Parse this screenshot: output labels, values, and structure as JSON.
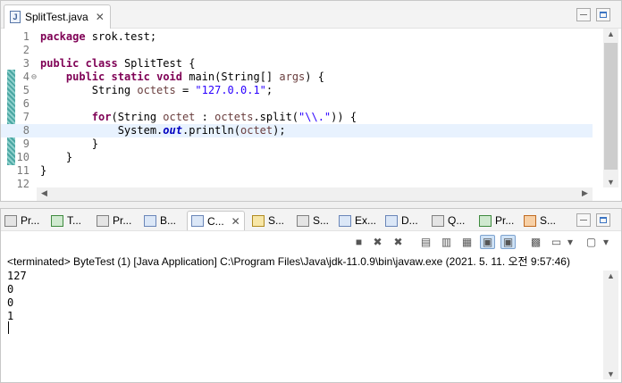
{
  "editor": {
    "tab_label": "SplitTest.java",
    "tab_close": "✕",
    "lines": [
      {
        "n": "1",
        "fold": "",
        "segs": [
          [
            "kw",
            "package"
          ],
          [
            "t",
            " srok.test;"
          ]
        ]
      },
      {
        "n": "2",
        "fold": "",
        "segs": []
      },
      {
        "n": "3",
        "fold": "",
        "segs": [
          [
            "kw",
            "public"
          ],
          [
            "t",
            " "
          ],
          [
            "kw",
            "class"
          ],
          [
            "t",
            " SplitTest {"
          ]
        ]
      },
      {
        "n": "4",
        "fold": "⊖",
        "segs": [
          [
            "t",
            "    "
          ],
          [
            "kw",
            "public"
          ],
          [
            "t",
            " "
          ],
          [
            "kw",
            "static"
          ],
          [
            "t",
            " "
          ],
          [
            "kw",
            "void"
          ],
          [
            "t",
            " main(String[] "
          ],
          [
            "var",
            "args"
          ],
          [
            "t",
            ") {"
          ]
        ]
      },
      {
        "n": "5",
        "fold": "",
        "segs": [
          [
            "t",
            "        String "
          ],
          [
            "var",
            "octets"
          ],
          [
            "t",
            " = "
          ],
          [
            "str",
            "\"127.0.0.1\""
          ],
          [
            "t",
            ";"
          ]
        ]
      },
      {
        "n": "6",
        "fold": "",
        "segs": []
      },
      {
        "n": "7",
        "fold": "",
        "segs": [
          [
            "t",
            "        "
          ],
          [
            "kw",
            "for"
          ],
          [
            "t",
            "(String "
          ],
          [
            "var",
            "octet"
          ],
          [
            "t",
            " : "
          ],
          [
            "var",
            "octets"
          ],
          [
            "t",
            ".split("
          ],
          [
            "str",
            "\"\\\\.\""
          ],
          [
            "t",
            ")) {"
          ]
        ]
      },
      {
        "n": "8",
        "fold": "",
        "segs": [
          [
            "t",
            "            System."
          ],
          [
            "fld",
            "out"
          ],
          [
            "t",
            ".println("
          ],
          [
            "var",
            "octet"
          ],
          [
            "t",
            ");"
          ]
        ],
        "current": true
      },
      {
        "n": "9",
        "fold": "",
        "segs": [
          [
            "t",
            "        }"
          ]
        ]
      },
      {
        "n": "10",
        "fold": "",
        "segs": [
          [
            "t",
            "    }"
          ]
        ]
      },
      {
        "n": "11",
        "fold": "",
        "segs": [
          [
            "t",
            "}"
          ]
        ]
      },
      {
        "n": "12",
        "fold": "",
        "segs": []
      }
    ]
  },
  "console": {
    "tabs": [
      {
        "label": "Pr...",
        "icon": "problems-icon",
        "color": "gray"
      },
      {
        "label": "T...",
        "icon": "tasks-icon",
        "color": "green"
      },
      {
        "label": "Pr...",
        "icon": "properties-icon",
        "color": "gray"
      },
      {
        "label": "B...",
        "icon": "bookmarks-icon",
        "color": "blue"
      },
      {
        "label": "C...",
        "icon": "console-icon",
        "color": "blue",
        "active": true,
        "close": "✕"
      },
      {
        "label": "S...",
        "icon": "servers-icon",
        "color": "yellow"
      },
      {
        "label": "S...",
        "icon": "snippets-icon",
        "color": "gray"
      },
      {
        "label": "Ex...",
        "icon": "explorer-icon",
        "color": "blue"
      },
      {
        "label": "D...",
        "icon": "search-icon",
        "color": "blue"
      },
      {
        "label": "Q...",
        "icon": "query-icon",
        "color": "gray"
      },
      {
        "label": "Pr...",
        "icon": "progress-icon",
        "color": "green"
      },
      {
        "label": "S...",
        "icon": "ssh-icon",
        "color": "orange"
      }
    ],
    "status": "<terminated> ByteTest (1) [Java Application] C:\\Program Files\\Java\\jdk-11.0.9\\bin\\javaw.exe (2021. 5. 11. 오전 9:57:46)",
    "output": [
      "127",
      "0",
      "0",
      "1"
    ],
    "toolbar": [
      {
        "name": "terminate-icon",
        "glyph": "■"
      },
      {
        "name": "remove-launch-icon",
        "glyph": "✖"
      },
      {
        "name": "remove-all-terminated-icon",
        "glyph": "✖"
      },
      {
        "name": "clear-console-icon",
        "glyph": "▤"
      },
      {
        "name": "scroll-lock-icon",
        "glyph": "▥"
      },
      {
        "name": "word-wrap-icon",
        "glyph": "▦"
      },
      {
        "name": "show-on-stdout-icon",
        "glyph": "▣",
        "pressed": true
      },
      {
        "name": "show-on-stderr-icon",
        "glyph": "▣",
        "pressed": true
      },
      {
        "name": "pin-console-icon",
        "glyph": "▩"
      },
      {
        "name": "display-console-icon",
        "glyph": "▭"
      },
      {
        "name": "display-dropdown-icon",
        "glyph": "▾"
      },
      {
        "name": "open-console-icon",
        "glyph": "▢"
      },
      {
        "name": "open-dropdown-icon",
        "glyph": "▾"
      }
    ]
  }
}
